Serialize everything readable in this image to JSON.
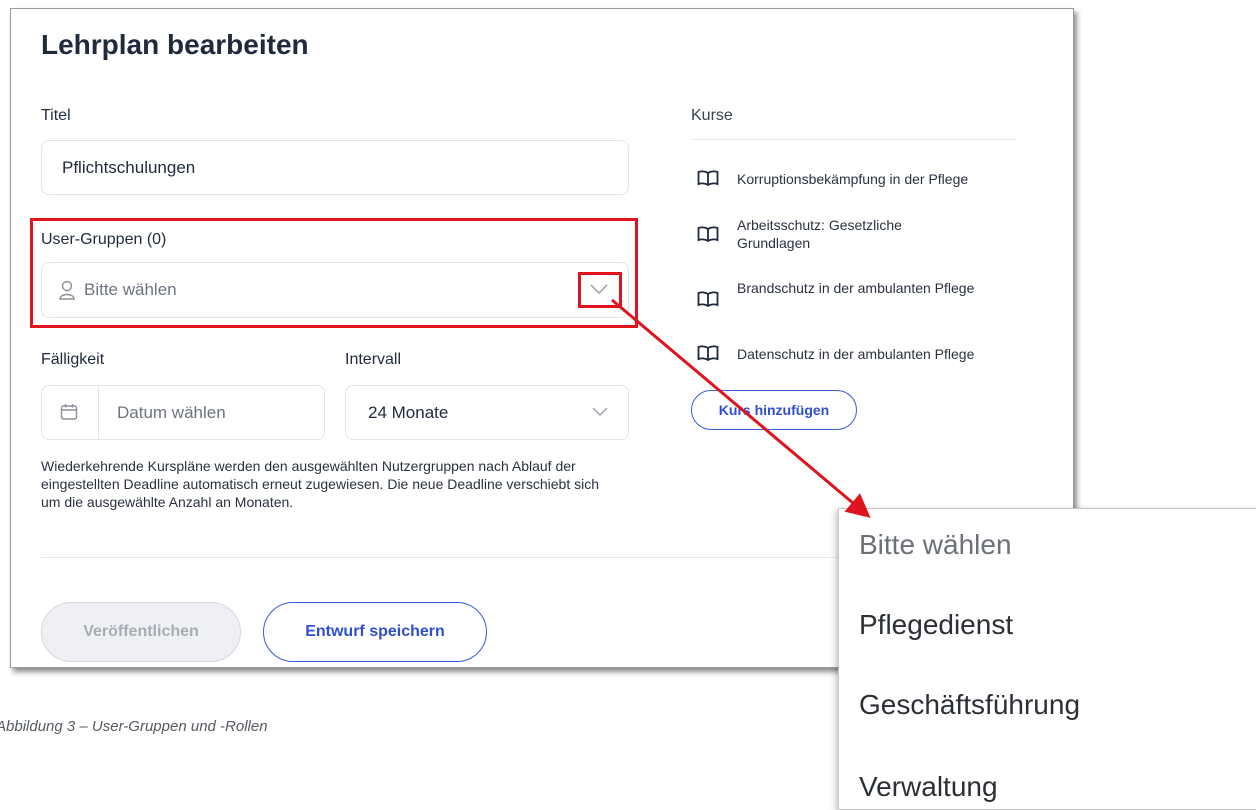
{
  "form": {
    "title": "Lehrplan bearbeiten",
    "titel_label": "Titel",
    "titel_value": "Pflichtschulungen",
    "groups_label": "User-Gruppen (0)",
    "groups_placeholder": "Bitte wählen",
    "due_label": "Fälligkeit",
    "due_placeholder": "Datum wählen",
    "interval_label": "Intervall",
    "interval_value": "24 Monate",
    "help_text": "Wiederkehrende Kurspläne werden den ausgewählten Nutzergruppen nach Ablauf der eingestellten Deadline automatisch erneut zugewiesen. Die neue Deadline verschiebt sich um die ausgewählte Anzahl an Monaten.",
    "publish_label": "Veröffentlichen",
    "draft_label": "Entwurf speichern"
  },
  "courses": {
    "heading": "Kurse",
    "items": [
      "Korruptionsbekämpfung in der Pflege",
      "Arbeitsschutz: Gesetzliche Grundlagen",
      "Brandschutz in der ambulanten Pflege",
      "Datenschutz in der ambulanten Pflege"
    ],
    "add_label": "Kurs hinzufügen"
  },
  "dropdown": {
    "options": [
      "Bitte wählen",
      "Pflegedienst",
      "Geschäftsführung",
      "Verwaltung"
    ]
  },
  "caption": "Abbildung 3 – User-Gruppen und -Rollen",
  "colors": {
    "accent": "#2f4fd1",
    "highlight": "#e0141e"
  },
  "icons": [
    "user-icon",
    "chevron-down-icon",
    "calendar-icon",
    "book-icon"
  ]
}
